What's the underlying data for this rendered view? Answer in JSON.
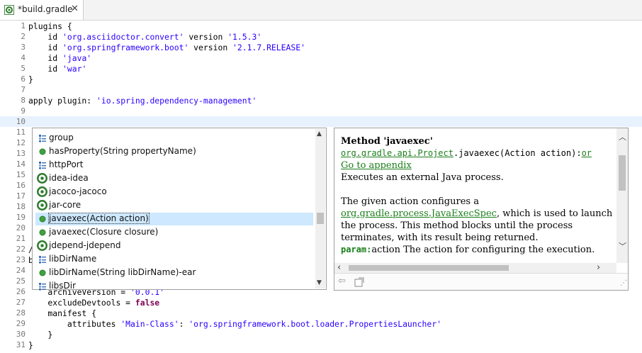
{
  "tab": {
    "title": "*build.gradle",
    "close": "✕"
  },
  "editor": {
    "lines": [
      {
        "n": "1",
        "segs": [
          {
            "t": "plugins {",
            "c": ""
          }
        ]
      },
      {
        "n": "2",
        "segs": [
          {
            "t": "    id ",
            "c": ""
          },
          {
            "t": "'org.asciidoctor.convert'",
            "c": "str"
          },
          {
            "t": " version ",
            "c": ""
          },
          {
            "t": "'1.5.3'",
            "c": "str"
          }
        ]
      },
      {
        "n": "3",
        "segs": [
          {
            "t": "    id ",
            "c": ""
          },
          {
            "t": "'org.springframework.boot'",
            "c": "str"
          },
          {
            "t": " version ",
            "c": ""
          },
          {
            "t": "'2.1.7.RELEASE'",
            "c": "str"
          }
        ]
      },
      {
        "n": "4",
        "segs": [
          {
            "t": "    id ",
            "c": ""
          },
          {
            "t": "'java'",
            "c": "str"
          }
        ]
      },
      {
        "n": "5",
        "segs": [
          {
            "t": "    id ",
            "c": ""
          },
          {
            "t": "'war'",
            "c": "str"
          }
        ]
      },
      {
        "n": "6",
        "segs": [
          {
            "t": "}",
            "c": ""
          }
        ]
      },
      {
        "n": "7",
        "segs": []
      },
      {
        "n": "8",
        "segs": [
          {
            "t": "apply plugin: ",
            "c": ""
          },
          {
            "t": "'io.spring.dependency-management'",
            "c": "str"
          }
        ]
      },
      {
        "n": "9",
        "segs": []
      },
      {
        "n": "10",
        "segs": [],
        "current": true
      },
      {
        "n": "11",
        "segs": []
      },
      {
        "n": "12",
        "segs": []
      },
      {
        "n": "13",
        "segs": []
      },
      {
        "n": "14",
        "segs": []
      },
      {
        "n": "15",
        "segs": []
      },
      {
        "n": "16",
        "segs": []
      },
      {
        "n": "17",
        "segs": []
      },
      {
        "n": "18",
        "segs": []
      },
      {
        "n": "19",
        "segs": []
      },
      {
        "n": "20",
        "segs": []
      },
      {
        "n": "21",
        "segs": []
      },
      {
        "n": "22",
        "segs": [
          {
            "t": "/",
            "c": ""
          }
        ]
      },
      {
        "n": "23",
        "segs": [
          {
            "t": "b",
            "c": ""
          }
        ]
      },
      {
        "n": "24",
        "segs": []
      },
      {
        "n": "25",
        "segs": []
      },
      {
        "n": "26",
        "segs": [
          {
            "t": "    archiveVersion = ",
            "c": ""
          },
          {
            "t": "'0.0.1'",
            "c": "str"
          }
        ]
      },
      {
        "n": "27",
        "segs": [
          {
            "t": "    excludeDevtools = ",
            "c": ""
          },
          {
            "t": "false",
            "c": "kw"
          }
        ]
      },
      {
        "n": "28",
        "segs": [
          {
            "t": "    manifest {",
            "c": ""
          }
        ]
      },
      {
        "n": "29",
        "segs": [
          {
            "t": "        attributes ",
            "c": ""
          },
          {
            "t": "'Main-Class'",
            "c": "str"
          },
          {
            "t": ": ",
            "c": ""
          },
          {
            "t": "'org.springframework.boot.loader.PropertiesLauncher'",
            "c": "str"
          }
        ]
      },
      {
        "n": "30",
        "segs": [
          {
            "t": "    }",
            "c": ""
          }
        ]
      },
      {
        "n": "31",
        "segs": [
          {
            "t": "}",
            "c": ""
          }
        ]
      }
    ]
  },
  "assist": {
    "items": [
      {
        "label": "group",
        "icon": "field-icon"
      },
      {
        "label": "hasProperty(String propertyName)",
        "icon": "method-icon"
      },
      {
        "label": "httpPort",
        "icon": "field-icon"
      },
      {
        "label": "idea-idea",
        "icon": "template-icon"
      },
      {
        "label": "jacoco-jacoco",
        "icon": "template-icon"
      },
      {
        "label": "jar-core",
        "icon": "template-icon"
      },
      {
        "label": "javaexec(Action action)",
        "icon": "method-icon",
        "selected": true
      },
      {
        "label": "javaexec(Closure closure)",
        "icon": "method-icon"
      },
      {
        "label": "jdepend-jdepend",
        "icon": "template-icon"
      },
      {
        "label": "libDirName",
        "icon": "field-icon"
      },
      {
        "label": "libDirName(String libDirName)-ear",
        "icon": "method-icon"
      },
      {
        "label": "libsDir",
        "icon": "field-icon"
      }
    ]
  },
  "doc": {
    "title": "Method 'javaexec'",
    "sig_link": "org.gradle.api.Project",
    "sig_rest": ".javaexec(Action action):",
    "sig_tail": "or",
    "appendix": "Go to appendix",
    "summary": "Executes an external Java process.",
    "p1": "The given action configures a ",
    "p1_link": "org.gradle.process.JavaExecSpec",
    "p1_rest": ", which is used to launch the process. This method blocks until the process terminates, with its result being returned.",
    "param_label": "param:",
    "param_text": "action The action for configuring the execution."
  },
  "colors": {
    "selection": "#cde8ff",
    "current_line": "#e8f2fe",
    "string": "#2a00ff",
    "keyword": "#7f0055",
    "link": "#1a7f1a"
  }
}
